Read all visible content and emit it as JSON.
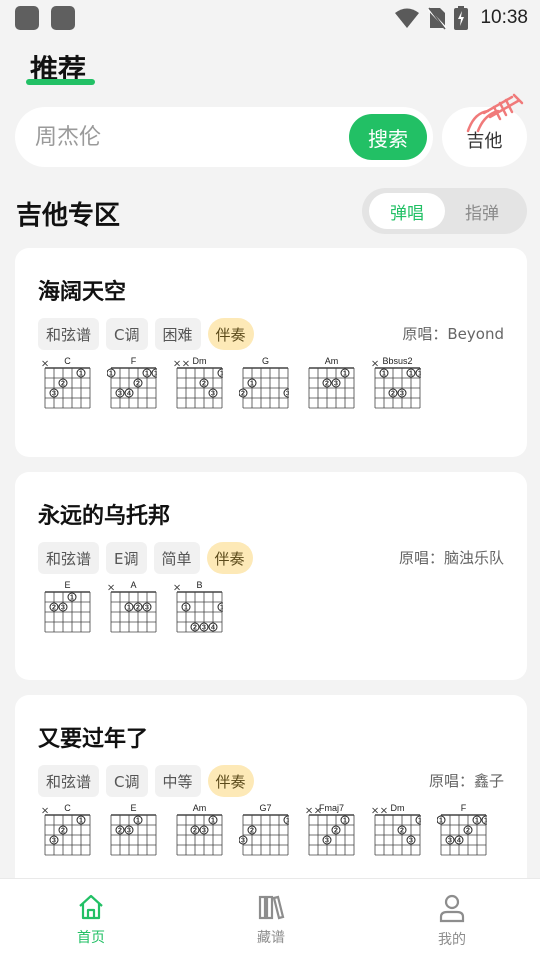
{
  "status": {
    "time": "10:38"
  },
  "header": {
    "tab_title": "推荐"
  },
  "search": {
    "placeholder": "周杰伦",
    "button_label": "搜索"
  },
  "instrument": {
    "label": "吉他"
  },
  "section": {
    "title": "吉他专区"
  },
  "modes": {
    "active": "弹唱",
    "inactive": "指弹"
  },
  "songs": [
    {
      "title": "海阔天空",
      "tags": [
        "和弦谱",
        "C调",
        "困难",
        "伴奏"
      ],
      "singer": "原唱：Beyond",
      "chords": [
        {
          "name": "C",
          "muted": [
            6
          ],
          "dots": [
            [
              5,
              3,
              3
            ],
            [
              4,
              2,
              2
            ],
            [
              2,
              1,
              1
            ]
          ]
        },
        {
          "name": "F",
          "muted": [],
          "dots": [
            [
              6,
              1,
              1
            ],
            [
              5,
              3,
              3
            ],
            [
              4,
              3,
              4
            ],
            [
              3,
              2,
              2
            ],
            [
              2,
              1,
              1
            ],
            [
              1,
              1,
              1
            ]
          ]
        },
        {
          "name": "Dm",
          "muted": [
            6,
            5
          ],
          "dots": [
            [
              3,
              2,
              2
            ],
            [
              2,
              3,
              3
            ],
            [
              1,
              1,
              1
            ]
          ]
        },
        {
          "name": "G",
          "muted": [],
          "dots": [
            [
              6,
              3,
              2
            ],
            [
              5,
              2,
              1
            ],
            [
              1,
              3,
              3
            ]
          ]
        },
        {
          "name": "Am",
          "muted": [],
          "dots": [
            [
              4,
              2,
              2
            ],
            [
              3,
              2,
              3
            ],
            [
              2,
              1,
              1
            ]
          ]
        },
        {
          "name": "Bbsus2",
          "muted": [
            6
          ],
          "dots": [
            [
              5,
              1,
              1
            ],
            [
              4,
              3,
              2
            ],
            [
              3,
              3,
              3
            ],
            [
              2,
              1,
              1
            ],
            [
              1,
              1,
              1
            ]
          ]
        }
      ]
    },
    {
      "title": "永远的乌托邦",
      "tags": [
        "和弦谱",
        "E调",
        "简单",
        "伴奏"
      ],
      "singer": "原唱：脑浊乐队",
      "chords": [
        {
          "name": "E",
          "muted": [],
          "dots": [
            [
              5,
              2,
              2
            ],
            [
              4,
              2,
              3
            ],
            [
              3,
              1,
              1
            ]
          ]
        },
        {
          "name": "A",
          "muted": [
            6
          ],
          "dots": [
            [
              4,
              2,
              1
            ],
            [
              3,
              2,
              2
            ],
            [
              2,
              2,
              3
            ]
          ]
        },
        {
          "name": "B",
          "muted": [
            6
          ],
          "dots": [
            [
              5,
              2,
              1
            ],
            [
              4,
              4,
              2
            ],
            [
              3,
              4,
              3
            ],
            [
              2,
              4,
              4
            ],
            [
              1,
              2,
              1
            ]
          ]
        }
      ]
    },
    {
      "title": "又要过年了",
      "tags": [
        "和弦谱",
        "C调",
        "中等",
        "伴奏"
      ],
      "singer": "原唱：鑫子",
      "chords": [
        {
          "name": "C",
          "muted": [
            6
          ],
          "dots": [
            [
              5,
              3,
              3
            ],
            [
              4,
              2,
              2
            ],
            [
              2,
              1,
              1
            ]
          ]
        },
        {
          "name": "E",
          "muted": [],
          "dots": [
            [
              5,
              2,
              2
            ],
            [
              4,
              2,
              3
            ],
            [
              3,
              1,
              1
            ]
          ]
        },
        {
          "name": "Am",
          "muted": [],
          "dots": [
            [
              4,
              2,
              2
            ],
            [
              3,
              2,
              3
            ],
            [
              2,
              1,
              1
            ]
          ]
        },
        {
          "name": "G7",
          "muted": [],
          "dots": [
            [
              6,
              3,
              3
            ],
            [
              5,
              2,
              2
            ],
            [
              1,
              1,
              1
            ]
          ]
        },
        {
          "name": "Fmaj7",
          "muted": [
            6,
            5
          ],
          "dots": [
            [
              4,
              3,
              3
            ],
            [
              3,
              2,
              2
            ],
            [
              2,
              1,
              1
            ]
          ]
        },
        {
          "name": "Dm",
          "muted": [
            6,
            5
          ],
          "dots": [
            [
              3,
              2,
              2
            ],
            [
              2,
              3,
              3
            ],
            [
              1,
              1,
              1
            ]
          ]
        },
        {
          "name": "F",
          "muted": [],
          "dots": [
            [
              6,
              1,
              1
            ],
            [
              5,
              3,
              3
            ],
            [
              4,
              3,
              4
            ],
            [
              3,
              2,
              2
            ],
            [
              2,
              1,
              1
            ],
            [
              1,
              1,
              1
            ]
          ]
        }
      ]
    }
  ],
  "nav": [
    {
      "label": "首页",
      "icon": "home-icon",
      "active": true
    },
    {
      "label": "藏谱",
      "icon": "library-icon",
      "active": false
    },
    {
      "label": "我的",
      "icon": "profile-icon",
      "active": false
    }
  ],
  "colors": {
    "accent": "#22c065",
    "accompaniment_tag": "#fde9b7",
    "background": "#f3f3f3"
  }
}
